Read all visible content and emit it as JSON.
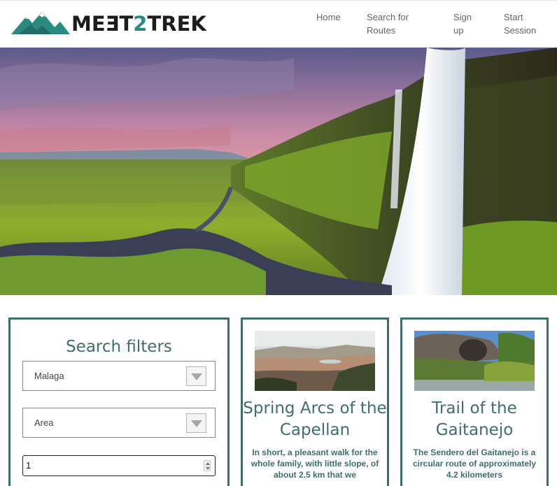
{
  "brand": {
    "logo_text_before": "MEƎT",
    "logo_text_two": "2",
    "logo_text_after": "TREK",
    "accent": "#2a8a80"
  },
  "nav": {
    "home": "Home",
    "search_routes": "Search for Routes",
    "sign_up": "Sign up",
    "start_session": "Start Session"
  },
  "hero": {
    "image": "waterfall-landscape"
  },
  "filters": {
    "title": "Search filters",
    "location_value": "Malaga",
    "area_value": "Area",
    "number_value": "1"
  },
  "routes": [
    {
      "title": "Spring Arcs of the Capellan",
      "description": "In short, a pleasant walk for the whole family, with little slope, of about 2.5 km that we",
      "image": "valley-landscape"
    },
    {
      "title": "Trail of the Gaitanejo",
      "description": "The Sendero del Gaitanejo is a circular route of approximately 4.2 kilometers",
      "image": "river-gorge"
    }
  ],
  "colors": {
    "card_border": "#3e6f6a",
    "title": "#3e6f6a",
    "nav_text": "#666666"
  }
}
